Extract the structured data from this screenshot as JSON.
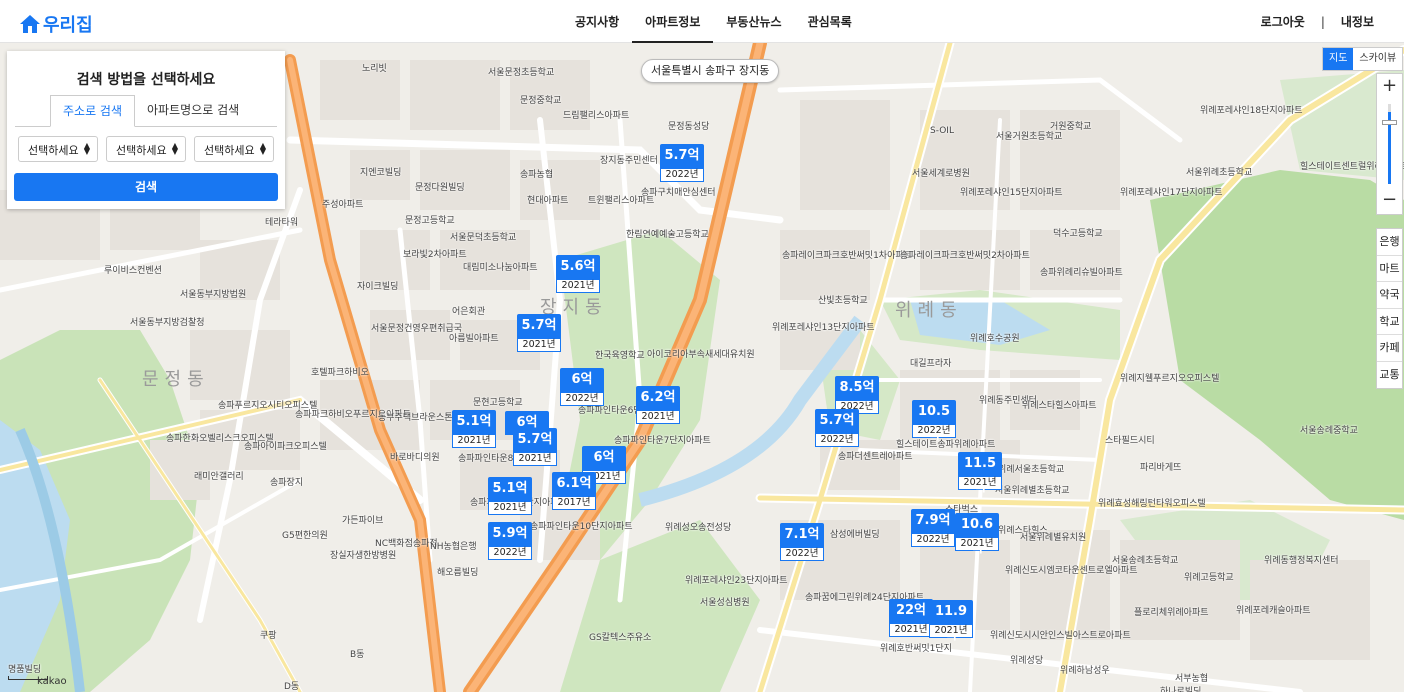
{
  "header": {
    "logo_text": "우리집",
    "nav": [
      "공지사항",
      "아파트정보",
      "부동산뉴스",
      "관심목록"
    ],
    "active_nav_index": 1,
    "logout": "로그아웃",
    "separator": "|",
    "my_info": "내정보",
    "accent_color": "#1877f2"
  },
  "search_panel": {
    "title": "검색 방법을 선택하세요",
    "tabs": [
      "주소로 검색",
      "아파트명으로 검색"
    ],
    "active_tab_index": 0,
    "selects": [
      "선택하세요",
      "선택하세요",
      "선택하세요"
    ],
    "search_button": "검색"
  },
  "map": {
    "location_label": "서울특별시 송파구 장지동",
    "map_types": [
      "지도",
      "스카이뷰"
    ],
    "active_map_type": "지도",
    "zoom_in": "+",
    "zoom_out": "−",
    "categories": [
      "은행",
      "마트",
      "약국",
      "학교",
      "카페",
      "교통"
    ],
    "dong_labels": [
      "장지동",
      "위례동",
      "문정동"
    ],
    "place_labels": [
      "노리빗",
      "서울문정초등학교",
      "문정중학교",
      "드림팰리스아파트",
      "문정동성당",
      "장지동주민센터",
      "송파구치매안심센터",
      "문정고등학교",
      "서울문덕초등학교",
      "송파농협",
      "현대아파트",
      "트윈팰리스아파트",
      "한림연예예술고등학교",
      "보라빛2차아파트",
      "대림미소나눔아파트",
      "주성아파트",
      "지엔코빌딩",
      "문정다원빌딩",
      "자이크빌딩",
      "어은회관",
      "서울문정건영우편취급국",
      "아름빌아파트",
      "한국육영학교",
      "아이코리아부속새세대유치원",
      "호텔파크하비오",
      "문현고등학교",
      "송파푸르지오시티오피스텔",
      "송파한화오벨리스크오피스텔",
      "송파아이파크오피스텔",
      "래미안갤러리",
      "송파파크하비오푸르지오아파트",
      "바로바디의원",
      "동부주택브라운스톤아파트",
      "송파파인타운8단지아파트",
      "송파파인타운6단지아파트",
      "송파파인타운7단지아파트",
      "송파파인타운9단지아파트",
      "송파파인타운10단지아파트",
      "NC백화점송파점",
      "가든파이브",
      "G5편한의원",
      "장실자생한방병원",
      "NH농협은행",
      "해오름빌딩",
      "서울동부지방검찰청",
      "서울동부지방법원",
      "루이비스컨벤션",
      "테라타워",
      "위례서울초등학교",
      "위례동주민센터",
      "대길프라자",
      "힐스테이트송파위례아파트",
      "송파더센트레아파트",
      "스타벅스",
      "송파레이크파크호반써밋1차아파트",
      "송파레이크파크호반써밋2차아파트",
      "산빛초등학교",
      "위례포레샤인13단지아파트",
      "위례호수공원",
      "위례포레샤인15단지아파트",
      "위례포레샤인17단지아파트",
      "서울위례초등학교",
      "힐스테이트센트럴위례아파트",
      "덕수고등학교",
      "서울거원초등학교",
      "거원중학교",
      "송파위례리슈빌아파트",
      "위례지웰푸르지오오피스텔",
      "위례스타힐스아파트",
      "스타필드시티",
      "파리바게뜨",
      "위례효성해링턴타워오피스텔",
      "서울위례별초등학교",
      "위례스타힐스",
      "서울위례별유치원",
      "위례신도시엠코타운센트로엘아파트",
      "송파꿈에그린위례24단지아파트",
      "위례포레샤인23단지아파트",
      "위례성오송전성당",
      "GS칼텍스주유소",
      "위례고등학교",
      "서울송례중학교",
      "서울송례초등학교",
      "위례동행정복지센터",
      "위례포레샤인18단지아파트",
      "위례호반써밋1단지",
      "송파장지",
      "S-OIL",
      "서울세계로병원",
      "위례신도시시안인스빌아스트로아파트",
      "플로리체위례아파트",
      "위례포레캐슬아파트",
      "서부농협",
      "하나로빌딩",
      "삼성에버빌딩",
      "서울성심병원",
      "쿠팡",
      "D동",
      "B동",
      "명품빌딩",
      "위례하남성우",
      "위례성당"
    ]
  },
  "markers": [
    {
      "price": "5.7억",
      "year": "2022년"
    },
    {
      "price": "5.6억",
      "year": "2021년"
    },
    {
      "price": "5.7억",
      "year": "2021년"
    },
    {
      "price": "6억",
      "year": "2022년"
    },
    {
      "price": "6.2억",
      "year": "2021년"
    },
    {
      "price": "5.1억",
      "year": "2021년"
    },
    {
      "price": "6억",
      "year": ""
    },
    {
      "price": "5.7억",
      "year": "2021년"
    },
    {
      "price": "6억",
      "year": "2021년"
    },
    {
      "price": "6.1억",
      "year": "2017년"
    },
    {
      "price": "5.1억",
      "year": "2021년"
    },
    {
      "price": "5.9억",
      "year": "2022년"
    },
    {
      "price": "8.5억",
      "year": "2022년"
    },
    {
      "price": "5.7억",
      "year": "2022년"
    },
    {
      "price": "10.5억",
      "year": "2022년"
    },
    {
      "price": "11.5억",
      "year": "2021년"
    },
    {
      "price": "7.1억",
      "year": "2022년"
    },
    {
      "price": "7.9억",
      "year": "2022년"
    },
    {
      "price": "10.6억",
      "year": "2021년"
    },
    {
      "price": "22억",
      "year": "2021년"
    },
    {
      "price": "11.9억",
      "year": "2021년"
    }
  ],
  "scale_label": "50m",
  "attribution": "kakao"
}
